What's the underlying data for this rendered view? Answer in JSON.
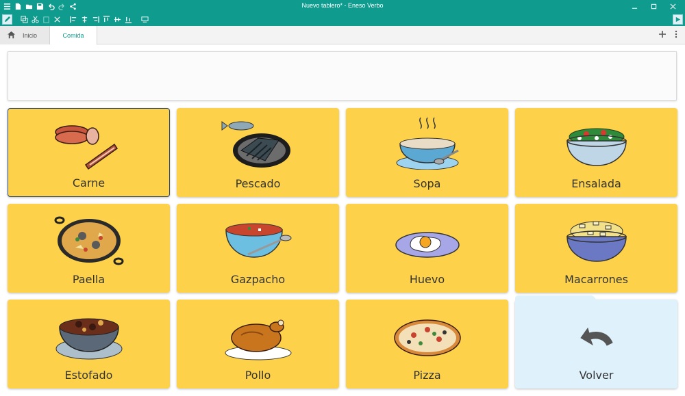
{
  "window": {
    "title": "Nuevo tablero* - Eneso Verbo"
  },
  "tabs": {
    "home_label": "Inicio",
    "active_label": "Comida"
  },
  "cells": [
    {
      "label": "Carne",
      "icon": "meat-icon"
    },
    {
      "label": "Pescado",
      "icon": "fish-icon"
    },
    {
      "label": "Sopa",
      "icon": "soup-icon"
    },
    {
      "label": "Ensalada",
      "icon": "salad-icon"
    },
    {
      "label": "Paella",
      "icon": "paella-icon"
    },
    {
      "label": "Gazpacho",
      "icon": "gazpacho-icon"
    },
    {
      "label": "Huevo",
      "icon": "egg-icon"
    },
    {
      "label": "Macarrones",
      "icon": "macaroni-icon"
    },
    {
      "label": "Estofado",
      "icon": "stew-icon"
    },
    {
      "label": "Pollo",
      "icon": "chicken-icon"
    },
    {
      "label": "Pizza",
      "icon": "pizza-icon"
    },
    {
      "label": "Volver",
      "icon": "back-arrow-icon"
    }
  ],
  "colors": {
    "accent": "#0f9b8e",
    "cell": "#fdd24a",
    "folder": "#dff2fb"
  }
}
